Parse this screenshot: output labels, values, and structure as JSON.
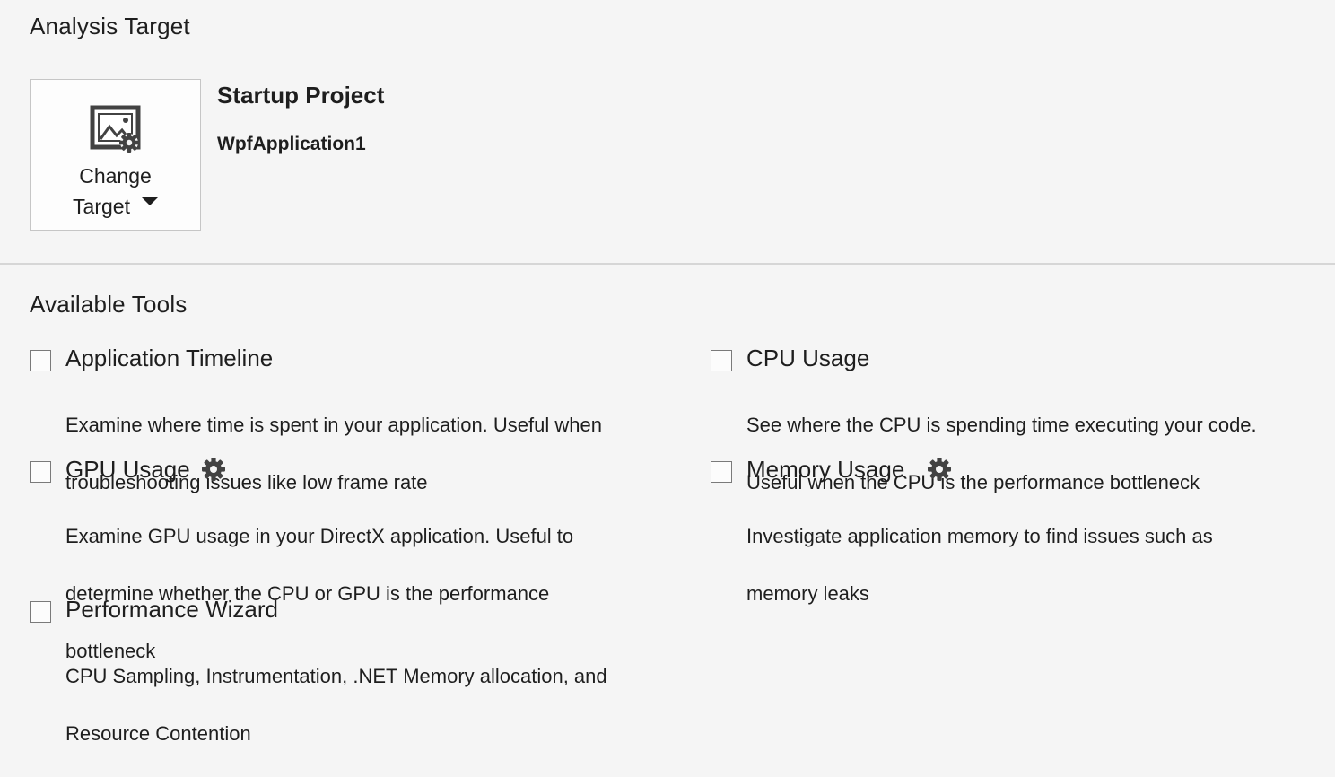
{
  "analysis_target": {
    "title": "Analysis Target",
    "change_target": {
      "line1": "Change",
      "line2": "Target",
      "icon": "change-target-icon"
    },
    "startup_heading": "Startup Project",
    "startup_value": "WpfApplication1"
  },
  "available_tools": {
    "title": "Available Tools",
    "items": [
      {
        "name": "Application Timeline",
        "checked": false,
        "has_settings": false,
        "description_lines": [
          "Examine where time is spent in your application. Useful when",
          "troubleshooting issues like low frame rate"
        ]
      },
      {
        "name": "CPU Usage",
        "checked": false,
        "has_settings": false,
        "description_lines": [
          "See where the CPU is spending time executing your code.",
          "Useful when the CPU is the performance bottleneck"
        ]
      },
      {
        "name": "GPU Usage",
        "checked": false,
        "has_settings": true,
        "description_lines": [
          "Examine GPU usage in your DirectX application. Useful to",
          "determine whether the CPU or GPU is the performance",
          "bottleneck"
        ]
      },
      {
        "name": "Memory Usage",
        "checked": false,
        "has_settings": true,
        "description_lines": [
          "Investigate application memory to find issues such as",
          "memory leaks"
        ]
      },
      {
        "name": "Performance Wizard",
        "checked": false,
        "has_settings": false,
        "description_lines": [
          "CPU Sampling, Instrumentation, .NET Memory allocation, and",
          "Resource Contention"
        ]
      }
    ]
  }
}
